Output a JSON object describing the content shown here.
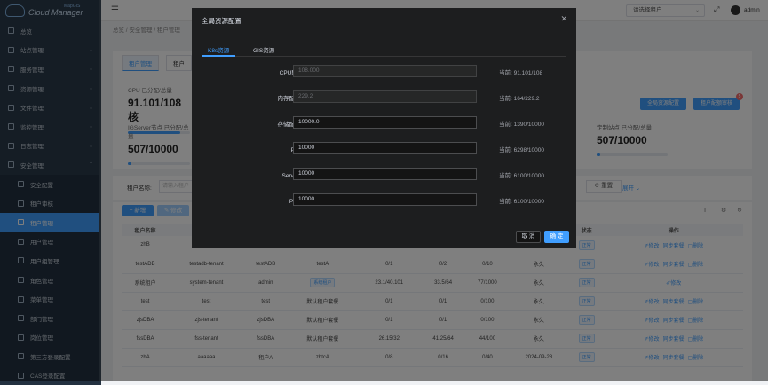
{
  "app": {
    "logo_sub": "MapGIS",
    "logo_main": "Cloud Manager"
  },
  "sidebar": {
    "items": [
      {
        "label": "总览",
        "arrow": ""
      },
      {
        "label": "站点管理",
        "arrow": "⌄"
      },
      {
        "label": "服务管理",
        "arrow": "⌄"
      },
      {
        "label": "资源管理",
        "arrow": "⌄"
      },
      {
        "label": "文件管理",
        "arrow": "⌄"
      },
      {
        "label": "监控管理",
        "arrow": "⌄"
      },
      {
        "label": "日志管理",
        "arrow": "⌄"
      },
      {
        "label": "安全管理",
        "arrow": "⌃"
      },
      {
        "label": "安全配置",
        "sub": true
      },
      {
        "label": "租户审核",
        "sub": true
      },
      {
        "label": "租户管理",
        "sub": true,
        "active": true
      },
      {
        "label": "用户管理",
        "sub": true
      },
      {
        "label": "用户组管理",
        "sub": true
      },
      {
        "label": "角色管理",
        "sub": true
      },
      {
        "label": "菜单管理",
        "sub": true
      },
      {
        "label": "部门管理",
        "sub": true
      },
      {
        "label": "岗位管理",
        "sub": true
      },
      {
        "label": "第三方登录配置",
        "sub": true
      },
      {
        "label": "CAS登录配置",
        "sub": true
      }
    ]
  },
  "header": {
    "tenant_placeholder": "请选择租户",
    "user": "admin"
  },
  "breadcrumb": "总览 / 安全管理 / 租户管理",
  "page": {
    "tabs": [
      "租户管理",
      "租户"
    ],
    "cpu_label": "CPU 已分配/总量",
    "cpu_value": "91.101/108 核",
    "cpu_progress": 0.84,
    "gserver_label": "IGServer节点 已分配/总量",
    "gserver_value": "507/10000",
    "custom_label": "定制站点 已分配/总量",
    "custom_value": "507/10000",
    "btn_global": "全局资源配置",
    "btn_audit": "租户配额审核",
    "audit_badge": "5",
    "search_label": "租户名称:",
    "search_placeholder": "请输入租户",
    "reset": "重置",
    "expand": "展开 ⌄",
    "new": "+ 新增",
    "edit": "✎ 修改"
  },
  "table": {
    "headers": [
      "",
      "租户名称",
      "",
      "",
      "",
      "",
      "",
      "",
      "期结束时间",
      "状态",
      "操作"
    ],
    "rows": [
      {
        "c": [
          "zhB",
          "bbbbb",
          "租户B",
          "zhtcB",
          "0/8",
          "0/16",
          "0/10",
          "2024-09-29"
        ],
        "status": "正常",
        "ops": [
          "✐修改",
          "同步套餐",
          "▢删除"
        ]
      },
      {
        "c": [
          "testADB",
          "testadb-tenant",
          "testADB",
          "testA",
          "0/1",
          "0/2",
          "0/10",
          "永久"
        ],
        "status": "正常",
        "ops": [
          "✐修改",
          "同步套餐",
          "▢删除"
        ]
      },
      {
        "c": [
          "系统租户",
          "system-tenant",
          "admin",
          "",
          "23.1/40.101",
          "33.5/64",
          "77/1000",
          "永久"
        ],
        "tag": "系统租户",
        "status": "正常",
        "ops": [
          "✐修改"
        ]
      },
      {
        "c": [
          "test",
          "test",
          "test",
          "默认租户套餐",
          "0/1",
          "0/1",
          "0/100",
          "永久"
        ],
        "status": "正常",
        "ops": [
          "✐修改",
          "同步套餐",
          "▢删除"
        ]
      },
      {
        "c": [
          "zjsDBA",
          "zjs-tenant",
          "zjsDBA",
          "默认租户套餐",
          "0/1",
          "0/1",
          "0/100",
          "永久"
        ],
        "status": "正常",
        "ops": [
          "✐修改",
          "同步套餐",
          "▢删除"
        ]
      },
      {
        "c": [
          "fssDBA",
          "fss-tenant",
          "fssDBA",
          "默认租户套餐",
          "26.15/32",
          "41.25/64",
          "44/100",
          "永久"
        ],
        "status": "正常",
        "ops": [
          "✐修改",
          "同步套餐",
          "▢删除"
        ]
      },
      {
        "c": [
          "zhA",
          "aaaaaa",
          "租户A",
          "zhtcA",
          "0/8",
          "0/16",
          "0/40",
          "2024-09-28"
        ],
        "status": "正常",
        "ops": [
          "✐修改",
          "同步套餐",
          "▢删除"
        ]
      }
    ]
  },
  "dialog": {
    "title": "全局资源配置",
    "tabs": [
      "K8s资源",
      "GIS资源"
    ],
    "rows": [
      {
        "label": "CPU配额(核):",
        "value": "108.000",
        "disabled": true,
        "now": "当前: 91.101/108"
      },
      {
        "label": "内存配额(GB):",
        "value": "229.2",
        "disabled": true,
        "now": "当前: 164/229.2"
      },
      {
        "label": "存储配额(GB):",
        "value": "10000.0",
        "disabled": false,
        "now": "当前: 1390/10000"
      },
      {
        "label": "Pod总数:",
        "value": "10000",
        "disabled": false,
        "now": "当前: 6298/10000"
      },
      {
        "label": "Service总数:",
        "value": "10000",
        "disabled": false,
        "now": "当前: 6100/10000"
      },
      {
        "label": "PVC总数:",
        "value": "10000",
        "disabled": false,
        "now": "当前: 6100/10000"
      }
    ],
    "cancel": "取 消",
    "ok": "确 定"
  }
}
